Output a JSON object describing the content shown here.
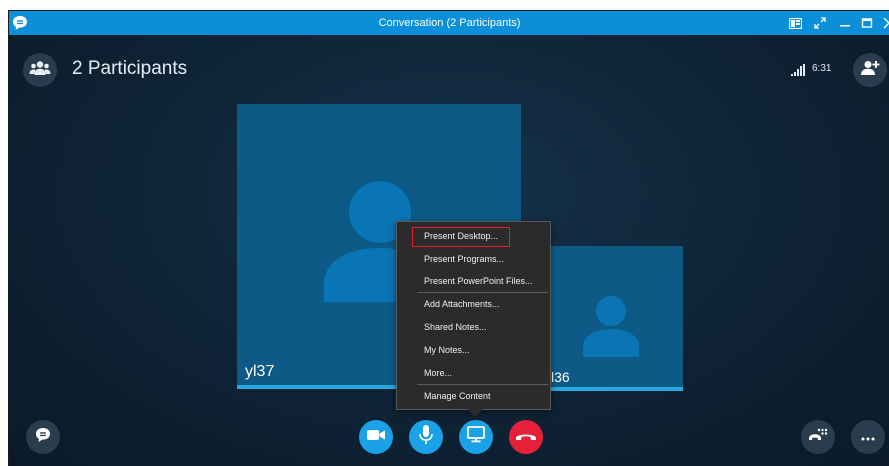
{
  "window": {
    "title": "Conversation (2 Participants)"
  },
  "header": {
    "participants_label": "2 Participants",
    "call_time": "6:31"
  },
  "tiles": [
    {
      "name": "yl37"
    },
    {
      "name": "l36"
    }
  ],
  "menu": {
    "items": [
      "Present Desktop...",
      "Present Programs...",
      "Present PowerPoint Files...",
      "Add Attachments...",
      "Shared Notes...",
      "My Notes...",
      "More...",
      "Manage Content"
    ],
    "highlighted_index": 0
  },
  "colors": {
    "titlebar": "#0a8fd8",
    "accent": "#1aa1e6",
    "hangup": "#e5213a",
    "tile": "#0d5a87",
    "highlight_border": "#e01f24"
  },
  "icons": {
    "app": "skype-chat-icon",
    "video": "video-camera-icon",
    "mic": "microphone-icon",
    "share": "monitor-icon",
    "hangup": "hang-up-icon"
  }
}
